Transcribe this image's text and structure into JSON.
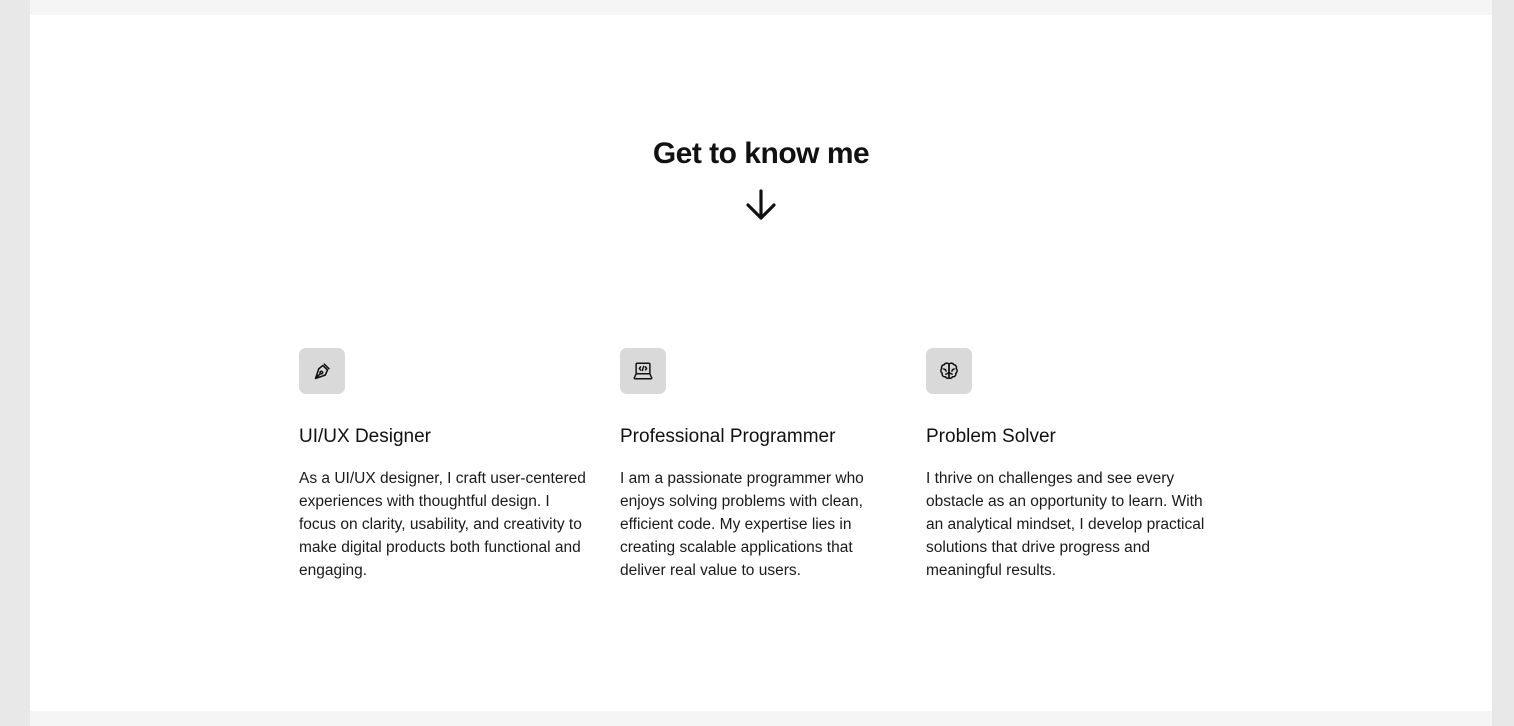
{
  "section": {
    "title": "Get to know me",
    "arrow_icon": "arrow-down-icon"
  },
  "cards": [
    {
      "icon": "pen-nib-icon",
      "title": "UI/UX Designer",
      "description": "As a UI/UX designer, I craft user-centered experiences with thoughtful design. I focus on clarity, usability, and creativity to make digital products both functional and engaging."
    },
    {
      "icon": "laptop-code-icon",
      "title": "Professional Programmer",
      "description": "I am a passionate programmer who enjoys solving problems with clean, efficient code. My expertise lies in creating scalable applications that deliver real value to users."
    },
    {
      "icon": "brain-icon",
      "title": "Problem Solver",
      "description": "I thrive on challenges and see every obstacle as an opportunity to learn. With an analytical mindset, I develop practical solutions that drive progress and meaningful results."
    }
  ],
  "colors": {
    "outer_background": "#e8e8e8",
    "page_background": "#f5f5f5",
    "section_background": "#ffffff",
    "icon_tile": "#d9d9d9",
    "text": "#111111"
  }
}
